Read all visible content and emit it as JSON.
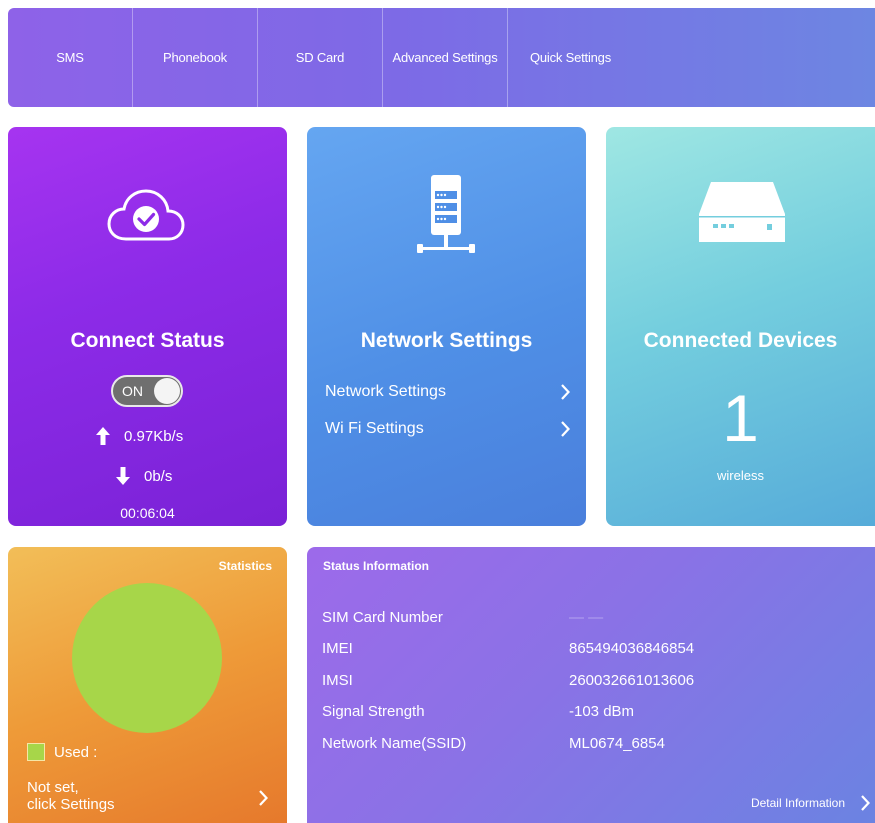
{
  "nav": {
    "items": [
      {
        "label": "SMS"
      },
      {
        "label": "Phonebook"
      },
      {
        "label": "SD Card"
      },
      {
        "label": "Advanced Settings"
      },
      {
        "label": "Quick Settings"
      }
    ]
  },
  "connect": {
    "title": "Connect Status",
    "icon": "cloud-check-icon",
    "toggle_label": "ON",
    "upload_rate": "0.97Kb/s",
    "download_rate": "0b/s",
    "uptime": "00:06:04"
  },
  "network": {
    "title": "Network Settings",
    "icon": "server-icon",
    "links": [
      {
        "label": "Network Settings"
      },
      {
        "label": "Wi Fi Settings"
      }
    ]
  },
  "devices": {
    "title": "Connected Devices",
    "icon": "router-icon",
    "count": "1",
    "type": "wireless"
  },
  "stats": {
    "title": "Statistics",
    "legend_label": "Used  :",
    "not_set_line1": "Not set,",
    "not_set_line2": "click Settings",
    "used_fraction": 1.0
  },
  "status": {
    "title": "Status Information",
    "rows": [
      {
        "key": "SIM Card Number",
        "value": "— —"
      },
      {
        "key": "IMEI",
        "value": "865494036846854"
      },
      {
        "key": "IMSI",
        "value": "260032661013606"
      },
      {
        "key": "Signal Strength",
        "value": "-103 dBm"
      },
      {
        "key": "Network Name(SSID)",
        "value": "ML0674_6854"
      }
    ],
    "detail_label": "Detail Information"
  },
  "colors": {
    "pie_used": "#a7d649",
    "connect_card": "#8d2be8",
    "network_card": "#4f8fe6",
    "devices_card": "#74cede",
    "stats_card": "#ee9a38",
    "status_card": "#8a72e6"
  }
}
